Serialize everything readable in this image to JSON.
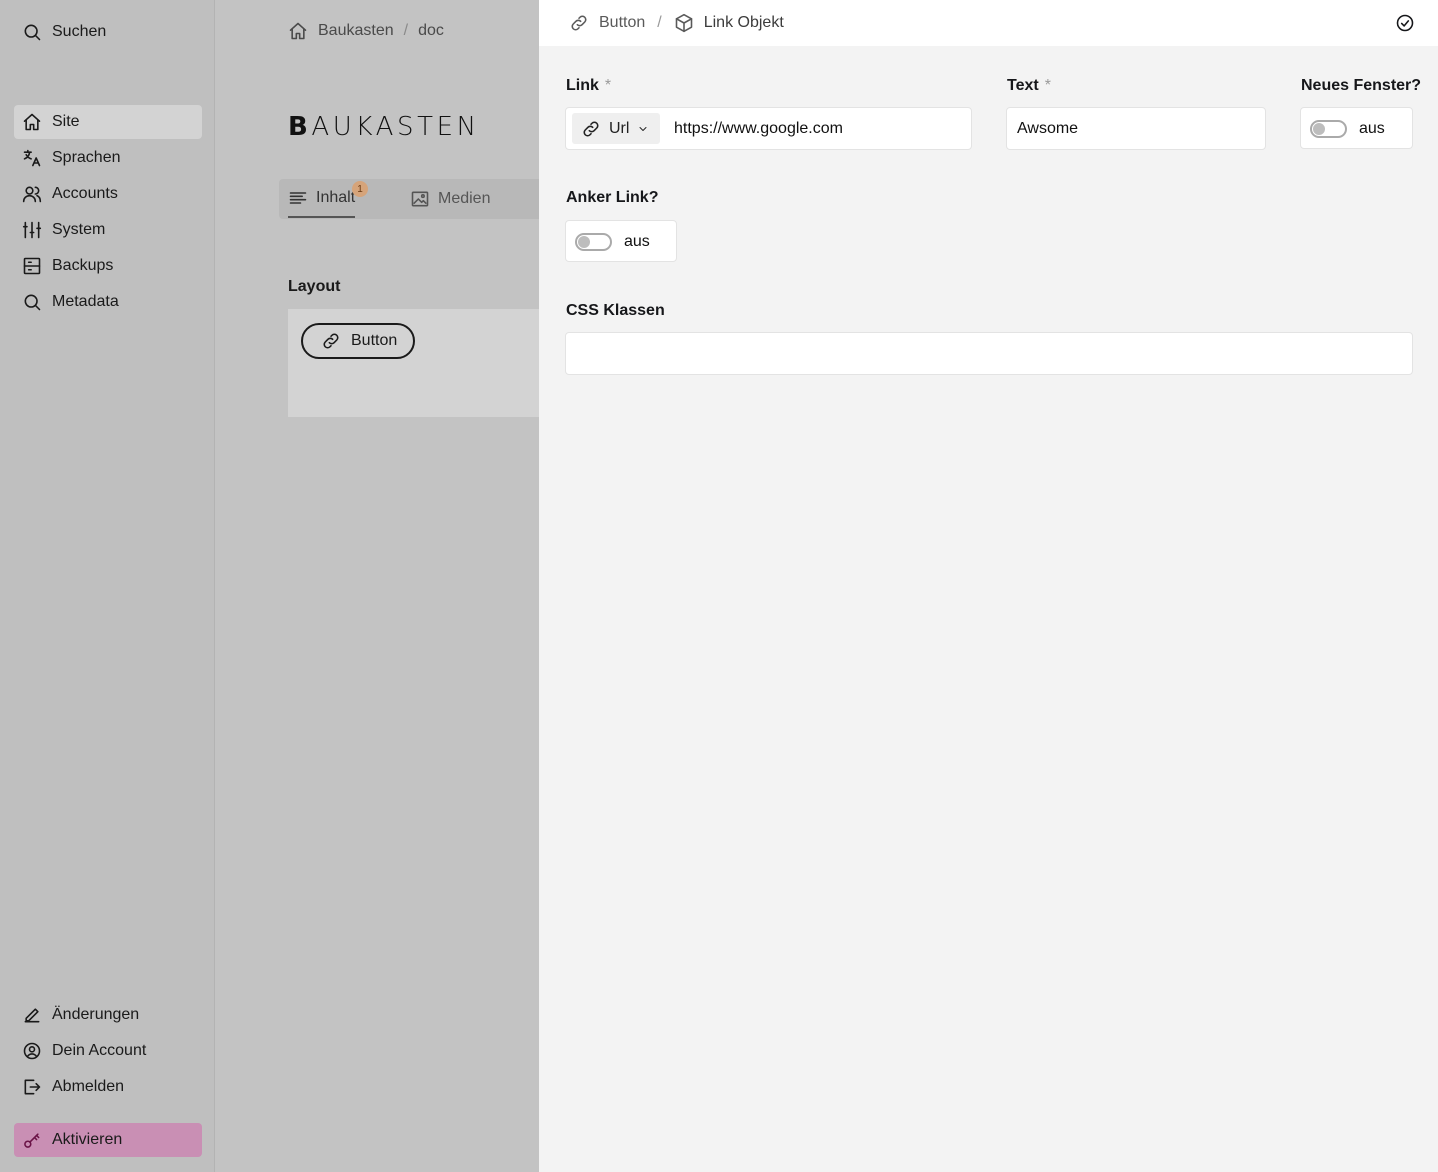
{
  "sidebar": {
    "search_label": "Suchen",
    "items": [
      {
        "label": "Site",
        "icon": "home-icon",
        "active": true
      },
      {
        "label": "Sprachen",
        "icon": "translate-icon"
      },
      {
        "label": "Accounts",
        "icon": "users-icon"
      },
      {
        "label": "System",
        "icon": "sliders-icon"
      },
      {
        "label": "Backups",
        "icon": "archive-icon"
      },
      {
        "label": "Metadata",
        "icon": "search-icon"
      }
    ],
    "bottom": [
      {
        "label": "Änderungen",
        "icon": "pencil-icon"
      },
      {
        "label": "Dein Account",
        "icon": "user-circle-icon"
      },
      {
        "label": "Abmelden",
        "icon": "logout-icon"
      }
    ],
    "activate_label": "Aktivieren"
  },
  "content": {
    "breadcrumb": [
      "Baukasten",
      "doc"
    ],
    "logo_first": "B",
    "logo_rest": "AUKASTEN",
    "tabs": [
      {
        "label": "Inhalt",
        "badge": "1",
        "active": true
      },
      {
        "label": "Medien"
      }
    ],
    "layout_label": "Layout",
    "block_button_label": "Button"
  },
  "drawer": {
    "breadcrumb": [
      "Button",
      "Link Objekt"
    ],
    "link": {
      "label": "Link",
      "required_mark": "*",
      "type": "Url",
      "value": "https://www.google.com"
    },
    "text": {
      "label": "Text",
      "required_mark": "*",
      "value": "Awsome"
    },
    "new_window": {
      "label": "Neues Fenster?",
      "state_label": "aus",
      "on": false
    },
    "anchor": {
      "label": "Anker Link?",
      "state_label": "aus",
      "on": false
    },
    "css_classes": {
      "label": "CSS Klassen",
      "value": ""
    }
  }
}
